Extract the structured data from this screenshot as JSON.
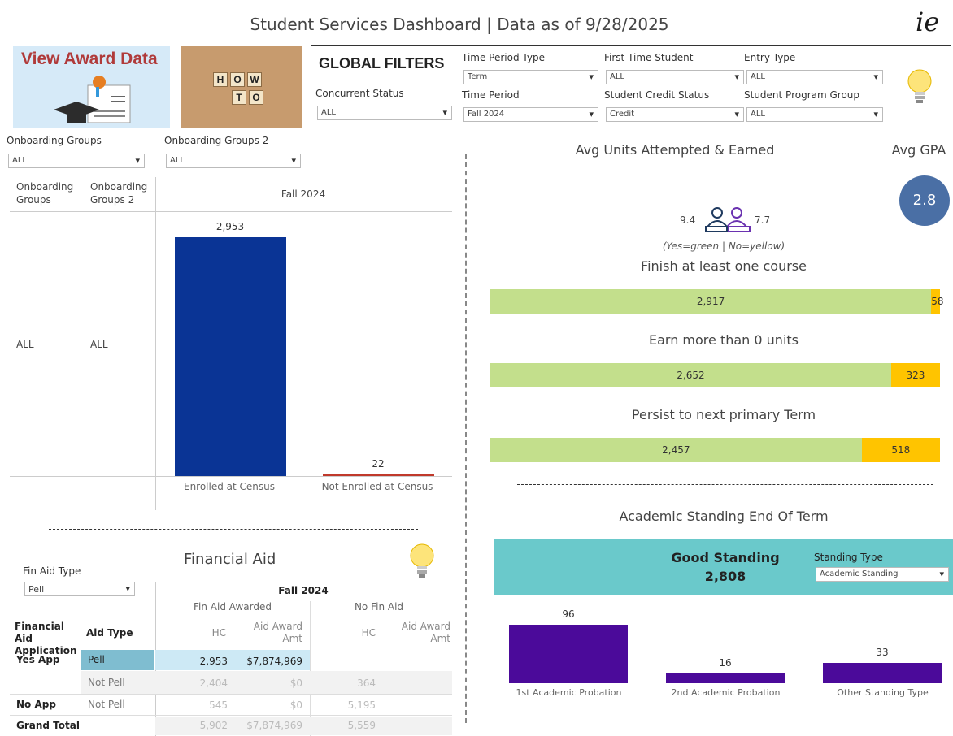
{
  "header": {
    "title": "Student Services Dashboard | Data as of 9/28/2025",
    "logo_text": "ie"
  },
  "tiles": {
    "award_label": "View Award Data",
    "howto_top": [
      "H",
      "O",
      "W"
    ],
    "howto_bottom": [
      "T",
      "O"
    ]
  },
  "global_filters": {
    "title": "GLOBAL FILTERS",
    "concurrent_status": {
      "label": "Concurrent Status",
      "value": "ALL"
    },
    "time_period_type": {
      "label": "Time Period Type",
      "value": "Term"
    },
    "time_period": {
      "label": "Time Period",
      "value": "Fall 2024"
    },
    "first_time_student": {
      "label": "First Time Student",
      "value": "ALL"
    },
    "student_credit_status": {
      "label": "Student Credit Status",
      "value": "Credit"
    },
    "entry_type": {
      "label": "Entry Type",
      "value": "ALL"
    },
    "student_program_group": {
      "label": "Student Program Group",
      "value": "ALL"
    }
  },
  "onboarding": {
    "filter1": {
      "label": "Onboarding Groups",
      "value": "ALL"
    },
    "filter2": {
      "label": "Onboarding Groups 2",
      "value": "ALL"
    },
    "col1": "Onboarding Groups",
    "col2": "Onboarding Groups 2",
    "period": "Fall 2024",
    "row1": "ALL",
    "row2": "ALL"
  },
  "enroll_chart": {
    "chart_data": {
      "type": "bar",
      "categories": [
        "Enrolled at Census",
        "Not Enrolled at Census"
      ],
      "values": [
        2953,
        22
      ],
      "value_labels": [
        "2,953",
        "22"
      ]
    }
  },
  "units": {
    "title": "Avg Units Attempted & Earned",
    "attempted": "9.4",
    "earned": "7.7"
  },
  "gpa": {
    "title": "Avg GPA",
    "value": "2.8"
  },
  "completion": {
    "legend": "(Yes=green | No=yellow)",
    "bars": [
      {
        "title": "Finish at least one course",
        "yes": 2917,
        "no": 58,
        "yes_label": "2,917",
        "no_label": "58"
      },
      {
        "title": "Earn more than 0 units",
        "yes": 2652,
        "no": 323,
        "yes_label": "2,652",
        "no_label": "323"
      },
      {
        "title": "Persist to next primary Term",
        "yes": 2457,
        "no": 518,
        "yes_label": "2,457",
        "no_label": "518"
      }
    ]
  },
  "standing": {
    "title": "Academic Standing End Of Term",
    "good_label": "Good Standing",
    "good_value": "2,808",
    "type_label": "Standing Type",
    "type_value": "Academic Standing",
    "chart_data": {
      "type": "bar",
      "categories": [
        "1st Academic Probation",
        "2nd Academic Probation",
        "Other Standing Type"
      ],
      "values": [
        96,
        16,
        33
      ],
      "value_labels": [
        "96",
        "16",
        "33"
      ]
    }
  },
  "financial_aid": {
    "title": "Financial Aid",
    "fin_aid_type": {
      "label": "Fin Aid Type",
      "value": "Pell"
    },
    "period": "Fall 2024",
    "group1": "Fin Aid Awarded",
    "group2": "No Fin Aid",
    "col_app": "Financial Aid Application",
    "col_type": "Aid Type",
    "col_hc": "HC",
    "col_amt": "Aid Award Amt",
    "rows": [
      {
        "app": "Yes App",
        "type": "Pell",
        "hc1": "2,953",
        "amt1": "$7,874,969",
        "hc2": "",
        "amt2": ""
      },
      {
        "app": "",
        "type": "Not Pell",
        "hc1": "2,404",
        "amt1": "$0",
        "hc2": "364",
        "amt2": ""
      },
      {
        "app": "No App",
        "type": "Not Pell",
        "hc1": "545",
        "amt1": "$0",
        "hc2": "5,195",
        "amt2": ""
      },
      {
        "app": "Grand Total",
        "type": "",
        "hc1": "5,902",
        "amt1": "$7,874,969",
        "hc2": "5,559",
        "amt2": ""
      }
    ]
  },
  "colors": {
    "enrolled": "#0a3495",
    "not_enrolled": "#c0392b",
    "yes": "#c3df8c",
    "no": "#ffc400",
    "standing": "#4b0a9a",
    "gpa": "#4a6fa5",
    "teal": "#6ac9cb"
  }
}
